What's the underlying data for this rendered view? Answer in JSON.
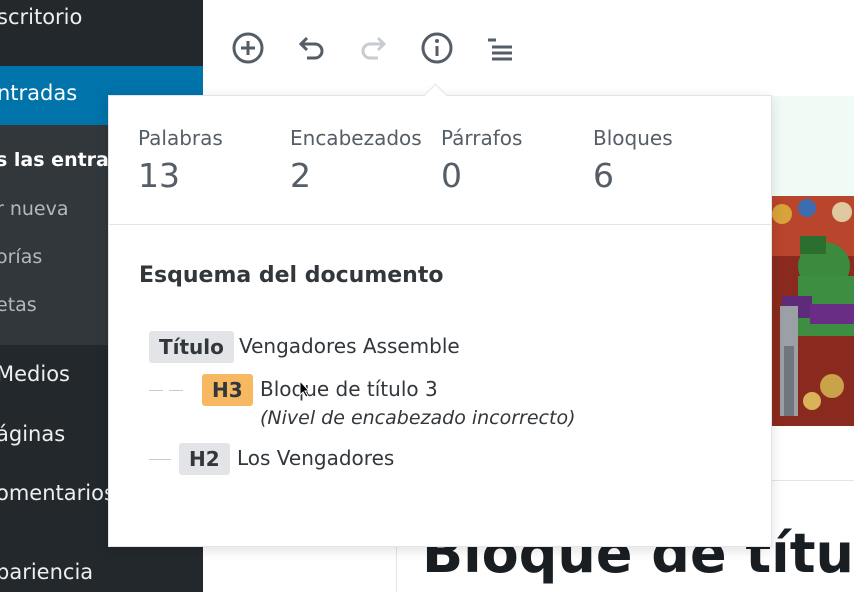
{
  "sidebar": {
    "top_item": "scritorio",
    "active_item": "ntradas",
    "submenu": [
      "s las entradas",
      "r nueva",
      "orías",
      "etas"
    ],
    "items": [
      "Medios",
      "áginas",
      "omentarios",
      "pariencia"
    ]
  },
  "toolbar": {
    "buttons": [
      "plus-circle-icon",
      "undo-icon",
      "redo-icon",
      "info-icon",
      "list-icon"
    ]
  },
  "popover": {
    "stats": [
      {
        "label": "Palabras",
        "value": "13"
      },
      {
        "label": "Encabezados",
        "value": "2"
      },
      {
        "label": "Párrafos",
        "value": "0"
      },
      {
        "label": "Bloques",
        "value": "6"
      }
    ],
    "outline_title": "Esquema del documento",
    "outline": [
      {
        "badge": "Título",
        "text": "Vengadores Assemble"
      },
      {
        "badge": "H3",
        "text": "Bloque de título 3",
        "warning": "(Nivel de encabezado incorrecto)"
      },
      {
        "badge": "H2",
        "text": "Los Vengadores"
      }
    ]
  },
  "editor": {
    "heading_fragment": "Bloque de títul"
  },
  "colors": {
    "sidebar": "#23282d",
    "active": "#0073aa",
    "submenu": "#32373c",
    "warning_badge": "#f6b861",
    "badge": "#e2e4e7"
  }
}
